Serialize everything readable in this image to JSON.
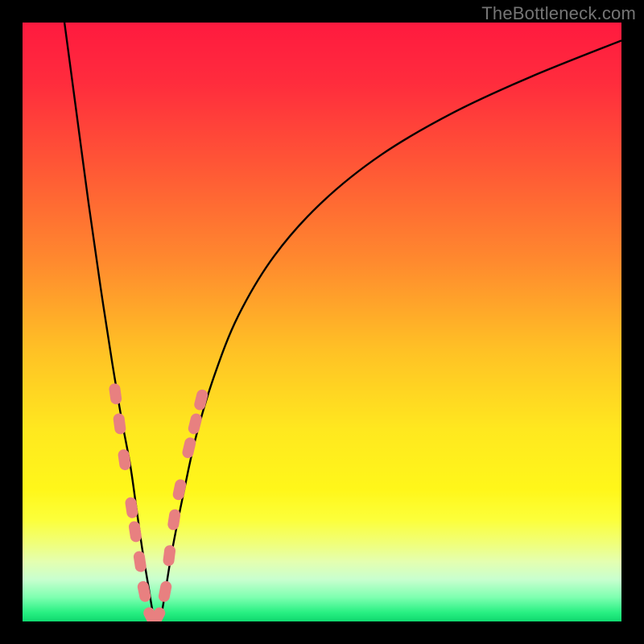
{
  "watermark": {
    "text": "TheBottleneck.com"
  },
  "colors": {
    "black": "#000000",
    "gradient_stops": [
      {
        "offset": 0.0,
        "color": "#ff1a3f"
      },
      {
        "offset": 0.1,
        "color": "#ff2c3d"
      },
      {
        "offset": 0.25,
        "color": "#ff5a35"
      },
      {
        "offset": 0.4,
        "color": "#ff8a2e"
      },
      {
        "offset": 0.55,
        "color": "#ffc225"
      },
      {
        "offset": 0.68,
        "color": "#ffe81f"
      },
      {
        "offset": 0.78,
        "color": "#fff71a"
      },
      {
        "offset": 0.83,
        "color": "#fcff3a"
      },
      {
        "offset": 0.87,
        "color": "#f0ff7a"
      },
      {
        "offset": 0.9,
        "color": "#e4ffb0"
      },
      {
        "offset": 0.93,
        "color": "#c8ffcf"
      },
      {
        "offset": 0.96,
        "color": "#7dffb0"
      },
      {
        "offset": 0.985,
        "color": "#28f082"
      },
      {
        "offset": 1.0,
        "color": "#0fd96f"
      }
    ],
    "curve": "#000000",
    "marker_fill": "#e88080",
    "marker_stroke": "#d86a6a"
  },
  "chart_data": {
    "type": "line",
    "title": "",
    "xlabel": "",
    "ylabel": "",
    "xlim": [
      0,
      100
    ],
    "ylim": [
      0,
      100
    ],
    "grid": false,
    "series": [
      {
        "name": "bottleneck-curve",
        "x": [
          7,
          9,
          11,
          13,
          15,
          16.5,
          18,
          19,
          20,
          21,
          22,
          23,
          24,
          25,
          27,
          29,
          32,
          36,
          42,
          50,
          60,
          72,
          85,
          100
        ],
        "values": [
          100,
          85,
          70,
          56,
          43,
          34,
          26,
          19,
          12,
          6,
          0.5,
          0.5,
          6,
          12,
          22,
          31,
          41,
          51,
          61,
          70,
          78,
          85,
          91,
          97
        ]
      }
    ],
    "markers": {
      "name": "highlighted-segments",
      "description": "pink pill markers along the curve near the bottom of the V",
      "points": [
        {
          "x": 15.5,
          "y": 38
        },
        {
          "x": 16.2,
          "y": 33
        },
        {
          "x": 17.0,
          "y": 27
        },
        {
          "x": 18.2,
          "y": 19
        },
        {
          "x": 18.8,
          "y": 15
        },
        {
          "x": 19.6,
          "y": 10
        },
        {
          "x": 20.3,
          "y": 5
        },
        {
          "x": 21.5,
          "y": 0.7
        },
        {
          "x": 22.5,
          "y": 0.7
        },
        {
          "x": 23.8,
          "y": 5
        },
        {
          "x": 24.5,
          "y": 11
        },
        {
          "x": 25.3,
          "y": 17
        },
        {
          "x": 26.2,
          "y": 22
        },
        {
          "x": 27.8,
          "y": 29
        },
        {
          "x": 28.8,
          "y": 33
        },
        {
          "x": 29.8,
          "y": 37
        }
      ]
    }
  }
}
